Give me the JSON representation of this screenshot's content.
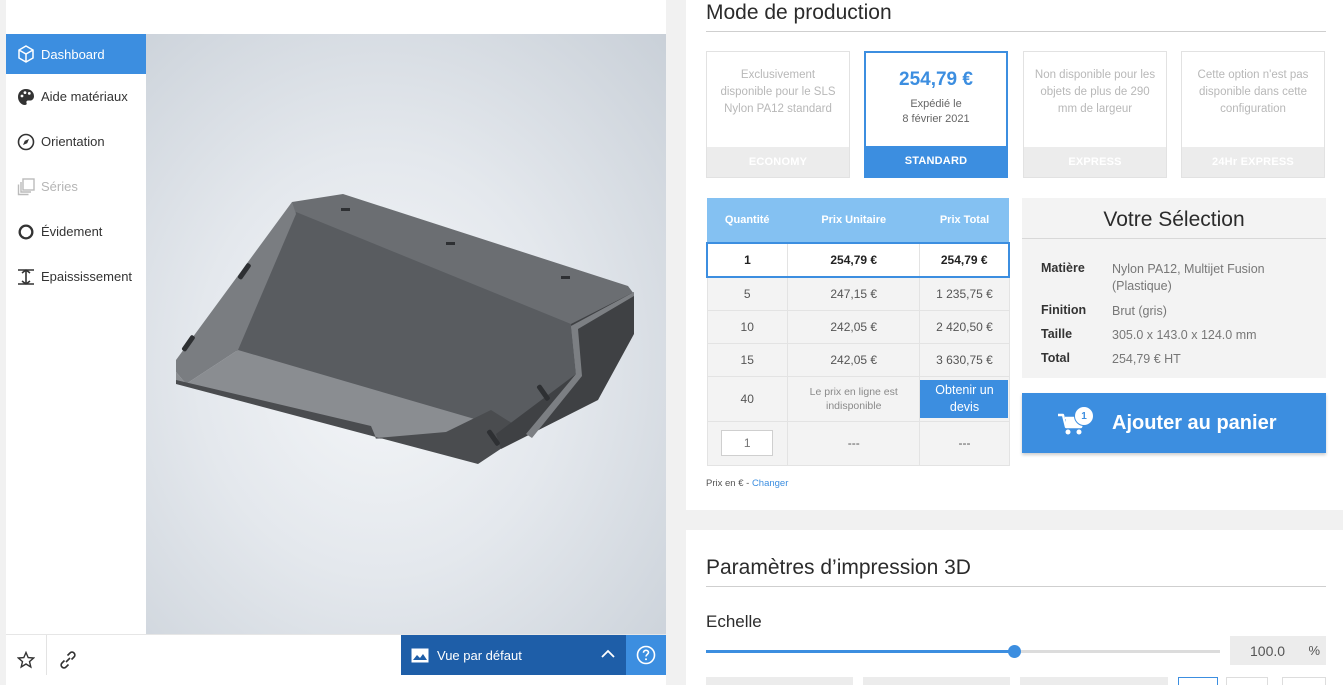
{
  "sidebar": {
    "items": [
      {
        "label": "Dashboard",
        "state": "active",
        "icon": "cube-icon"
      },
      {
        "label": "Aide matériaux",
        "state": "normal",
        "icon": "palette-icon"
      },
      {
        "label": "Orientation",
        "state": "normal",
        "icon": "compass-icon"
      },
      {
        "label": "Séries",
        "state": "disabled",
        "icon": "stack-icon"
      },
      {
        "label": "Évidement",
        "state": "normal",
        "icon": "hollow-icon"
      },
      {
        "label": "Epaississement",
        "state": "normal",
        "icon": "thickness-icon"
      }
    ]
  },
  "viewer": {
    "view_label": "Vue par défaut",
    "icons": [
      "star-icon",
      "link-icon",
      "image-icon",
      "chevron-up-icon",
      "help-icon"
    ]
  },
  "production": {
    "title": "Mode de production",
    "options": [
      {
        "footer": "ECONOMY",
        "description": "Exclusivement disponible pour le SLS Nylon PA12 standard",
        "selected": false
      },
      {
        "footer": "STANDARD",
        "price": "254,79 €",
        "ship_line1": "Expédié le",
        "ship_line2": "8 février 2021",
        "selected": true
      },
      {
        "footer": "EXPRESS",
        "description": "Non disponible pour les objets de plus de 290 mm de largeur",
        "selected": false
      },
      {
        "footer": "24Hr EXPRESS",
        "description": "Cette option n'est pas disponible dans cette configuration",
        "selected": false
      }
    ]
  },
  "pricing": {
    "headers": [
      "Quantité",
      "Prix Unitaire",
      "Prix Total"
    ],
    "rows": [
      {
        "qty": "1",
        "unit": "254,79 €",
        "total": "254,79 €"
      },
      {
        "qty": "5",
        "unit": "247,15 €",
        "total": "1 235,75 €"
      },
      {
        "qty": "10",
        "unit": "242,05 €",
        "total": "2 420,50 €"
      },
      {
        "qty": "15",
        "unit": "242,05 €",
        "total": "3 630,75 €"
      }
    ],
    "row_40": {
      "qty": "40",
      "note": "Le prix en ligne est indisponible",
      "quote_line1": "Obtenir un",
      "quote_line2": "devis"
    },
    "custom_row": {
      "placeholder": "1",
      "unit": "---",
      "total": "---"
    },
    "currency_label": "Prix en € - ",
    "currency_link": "Changer"
  },
  "selection": {
    "title": "Votre Sélection",
    "material_key": "Matière",
    "material_value": "Nylon PA12, Multijet Fusion (Plastique)",
    "finish_key": "Finition",
    "finish_value": "Brut (gris)",
    "size_key": "Taille",
    "size_value": "305.0 x 143.0 x 124.0 mm",
    "total_key": "Total",
    "total_value": "254,79 € HT"
  },
  "cart": {
    "label": "Ajouter au panier",
    "badge": "1"
  },
  "params": {
    "title": "Paramètres d’impression 3D",
    "scale_label": "Echelle",
    "scale_value": "100.0",
    "scale_unit": "%",
    "slider_fraction": 0.6
  },
  "colors": {
    "accent": "#3c8ee0",
    "dark_accent": "#1e5ea8",
    "header_light": "#84c1f2"
  }
}
